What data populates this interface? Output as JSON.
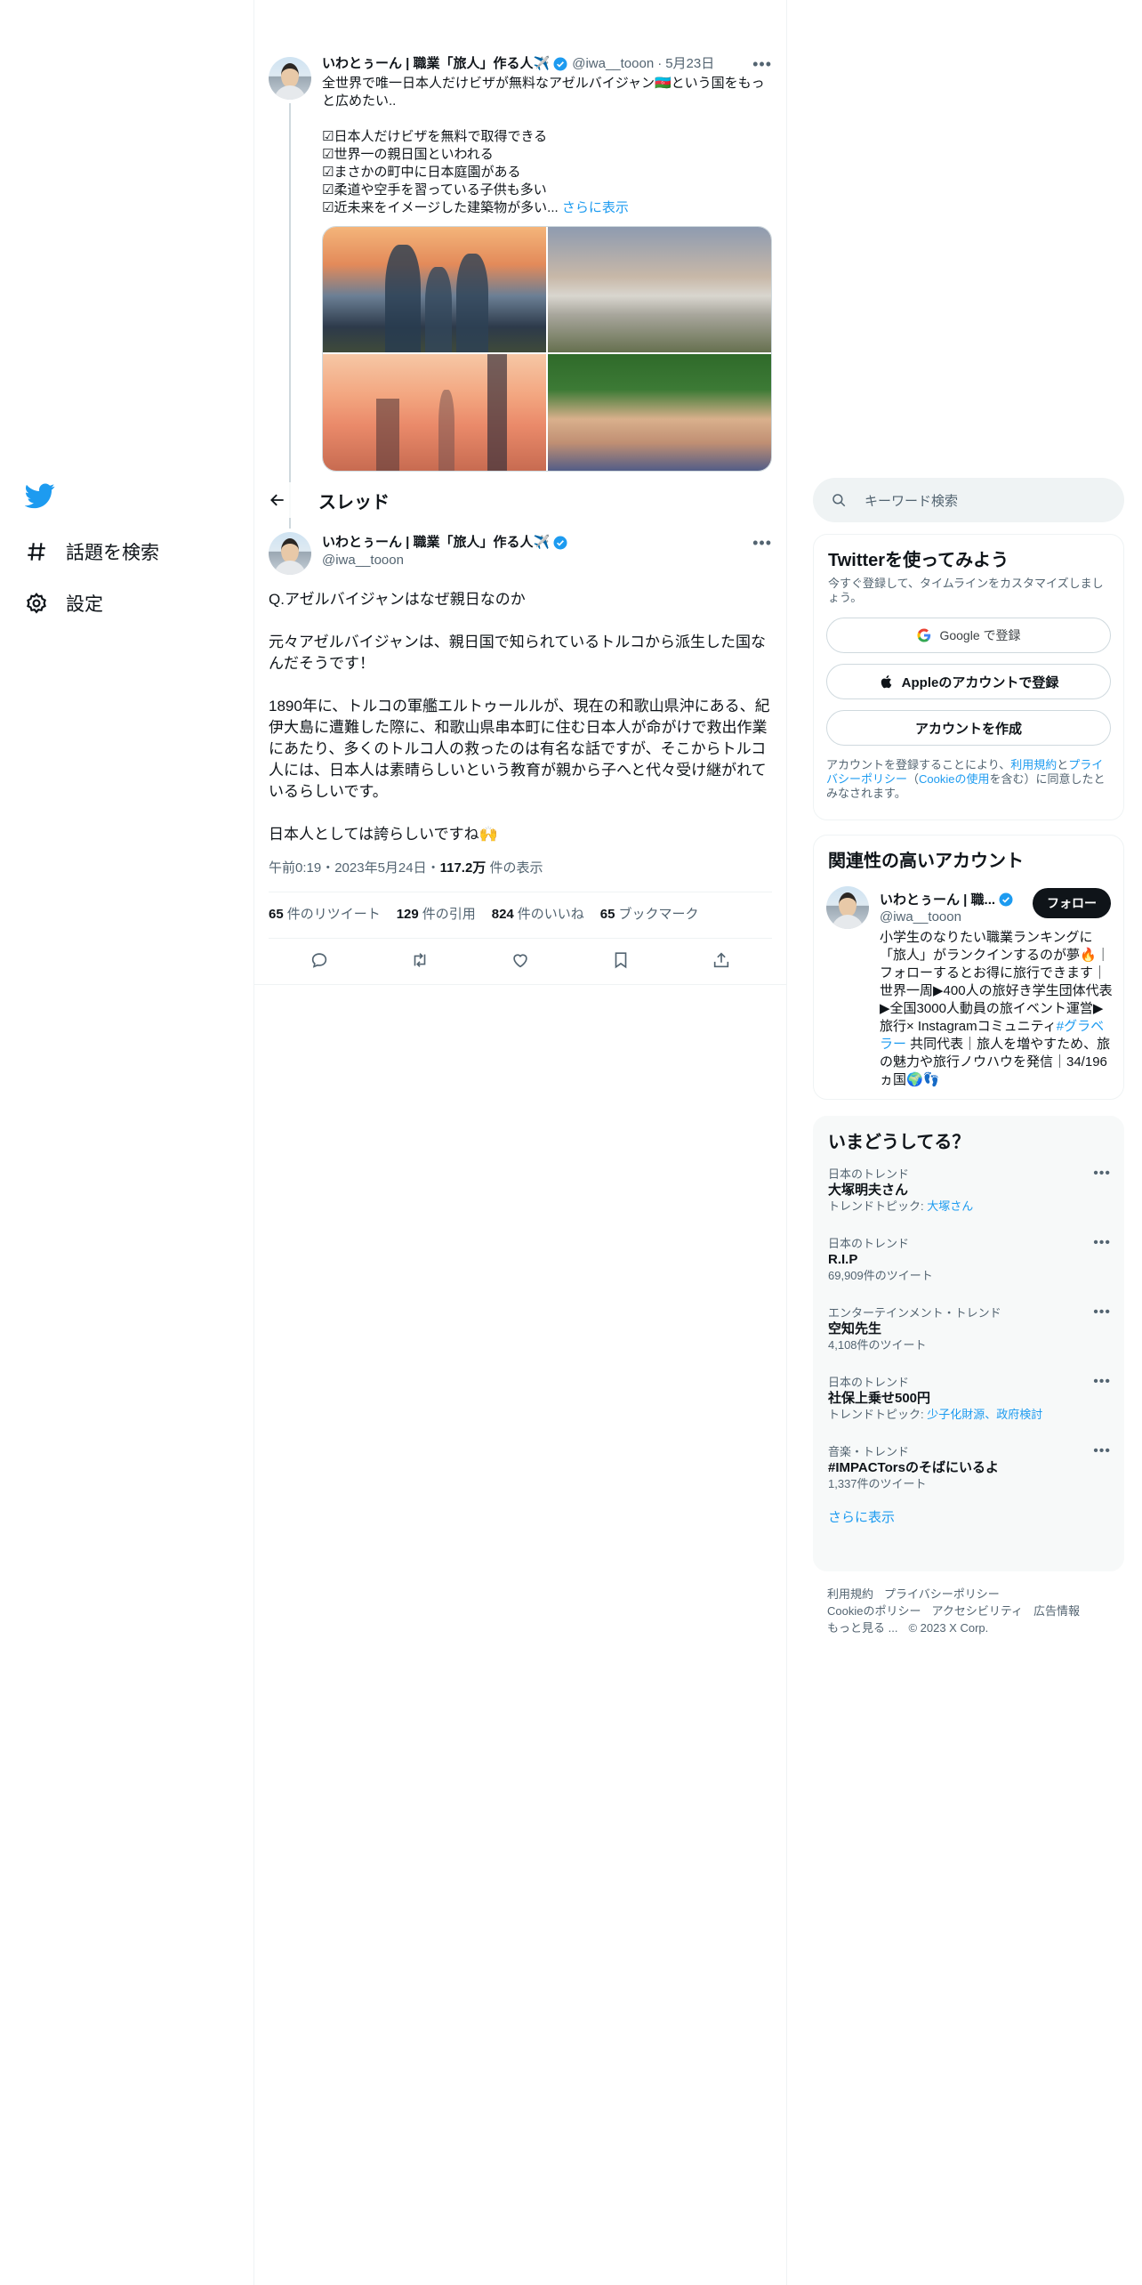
{
  "nav": {
    "items": [
      {
        "label": "話題を検索"
      },
      {
        "label": "設定"
      }
    ]
  },
  "parent_tweet": {
    "name": "いわとぅーん | 職業「旅人」作る人✈️",
    "handle": "@iwa__tooon",
    "date": "5月23日",
    "text": "全世界で唯一日本人だけビザが無料なアゼルバイジャン🇦🇿という国をもっと広めたい..\n\n☑日本人だけビザを無料で取得できる\n☑世界一の親日国といわれる\n☑まさかの町中に日本庭園がある\n☑柔道や空手を習っている子供も多い\n☑近未来をイメージした建築物が多い...",
    "show_more": "さらに表示"
  },
  "thread": {
    "title": "スレッド"
  },
  "main_tweet": {
    "name": "いわとぅーん | 職業「旅人」作る人✈️",
    "handle": "@iwa__tooon",
    "text": "Q.アゼルバイジャンはなぜ親日なのか\n\n元々アゼルバイジャンは、親日国で知られているトルコから派生した国なんだそうです！\n\n1890年に、トルコの軍艦エルトゥールルが、現在の和歌山県沖にある、紀伊大島に遭難した際に、和歌山県串本町に住む日本人が命がけで救出作業にあたり、多くのトルコ人の救ったのは有名な話ですが、そこからトルコ人には、日本人は素晴らしいという教育が親から子へと代々受け継がれているらしいです。\n\n日本人としては誇らしいですね🙌",
    "time": "午前0:19・2023年5月24日・",
    "views_count": "117.2万",
    "views_label": " 件の表示",
    "stats": [
      {
        "count": "65",
        "label": "件のリツイート"
      },
      {
        "count": "129",
        "label": "件の引用"
      },
      {
        "count": "824",
        "label": "件のいいね"
      },
      {
        "count": "65",
        "label": "ブックマーク"
      }
    ]
  },
  "search": {
    "placeholder": "キーワード検索"
  },
  "signup": {
    "title": "Twitterを使ってみよう",
    "subtitle": "今すぐ登録して、タイムラインをカスタマイズしましょう。",
    "google": "Google で登録",
    "apple": "Appleのアカウントで登録",
    "create": "アカウントを作成",
    "legal_1": "アカウントを登録することにより、",
    "legal_terms": "利用規約",
    "legal_2": "と",
    "legal_privacy": "プライバシーポリシー",
    "legal_3": "（",
    "legal_cookie": "Cookieの使用",
    "legal_4": "を含む）に同意したとみなされます。"
  },
  "related": {
    "title": "関連性の高いアカウント",
    "name": "いわとぅーん | 職...",
    "handle": "@iwa__tooon",
    "follow": "フォロー",
    "bio_1": "小学生のなりたい職業ランキングに「旅人」がランクインするのが夢🔥｜フォローするとお得に旅行できます｜世界一周▶400人の旅好き学生団体代表▶全国3000人動員の旅イベント運営▶旅行× Instagramコミュニティ",
    "bio_tag": "#グラベラー",
    "bio_2": " 共同代表｜旅人を増やすため、旅の魅力や旅行ノウハウを発信｜34/196ヵ国🌍👣"
  },
  "trends": {
    "title": "いまどうしてる？",
    "items": [
      {
        "context": "日本のトレンド",
        "name": "大塚明夫さん",
        "meta_prefix": "トレンドトピック: ",
        "meta_link": "大塚さん"
      },
      {
        "context": "日本のトレンド",
        "name": "R.I.P",
        "meta_prefix": "69,909件のツイート",
        "meta_link": ""
      },
      {
        "context": "エンターテインメント・トレンド",
        "name": "空知先生",
        "meta_prefix": "4,108件のツイート",
        "meta_link": ""
      },
      {
        "context": "日本のトレンド",
        "name": "社保上乗せ500円",
        "meta_prefix": "トレンドトピック: ",
        "meta_link": "少子化財源、政府検討"
      },
      {
        "context": "音楽・トレンド",
        "name": "#IMPACTorsのそばにいるよ",
        "meta_prefix": "1,337件のツイート",
        "meta_link": ""
      }
    ],
    "show_more": "さらに表示"
  },
  "footer": {
    "links": [
      "利用規約",
      "プライバシーポリシー",
      "Cookieのポリシー",
      "アクセシビリティ",
      "広告情報",
      "もっと見る ..."
    ],
    "copyright": "© 2023 X Corp."
  },
  "colors": {
    "accent": "#1d9bf0",
    "text": "#0f1419",
    "muted": "#536471"
  }
}
